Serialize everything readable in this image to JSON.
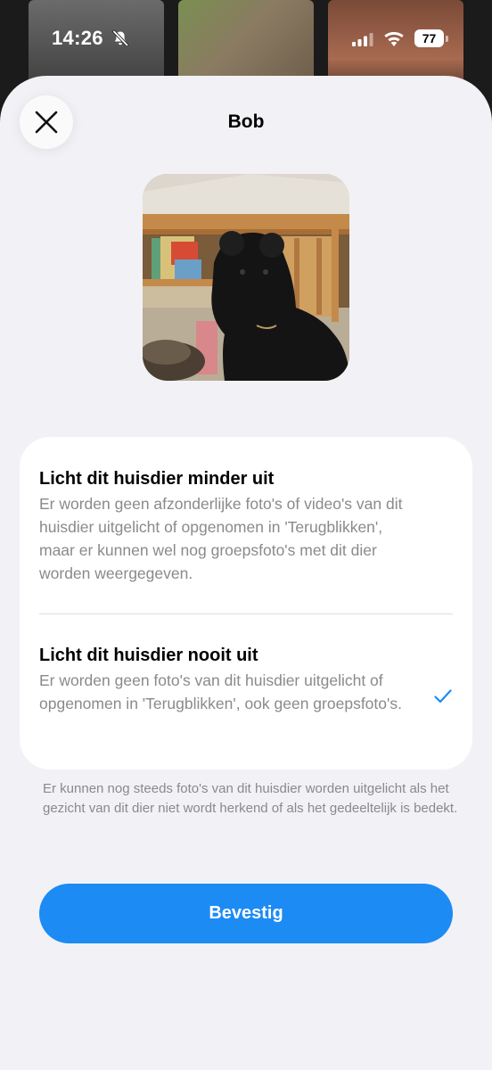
{
  "status_bar": {
    "time": "14:26",
    "battery": "77",
    "icons": [
      "bell-off-icon",
      "signal-icon",
      "wifi-icon",
      "battery-icon"
    ]
  },
  "sheet": {
    "title": "Bob",
    "close_icon": "close-icon",
    "photo": "pet-photo"
  },
  "options": [
    {
      "title": "Licht dit huisdier minder uit",
      "description": "Er worden geen afzonderlijke foto's of video's van dit huisdier uitgelicht of opgenomen in 'Terugblikken', maar er kunnen wel nog groepsfoto's met dit dier worden weergegeven.",
      "selected": false
    },
    {
      "title": "Licht dit huisdier nooit uit",
      "description": "Er worden geen foto's van dit huisdier uitgelicht of opgenomen in 'Terugblikken', ook geen groepsfoto's.",
      "selected": true
    }
  ],
  "footnote": "Er kunnen nog steeds foto's van dit huisdier worden uitgelicht als het gezicht van dit dier niet wordt herkend of als het gedeeltelijk is bedekt.",
  "confirm_label": "Bevestig",
  "colors": {
    "accent": "#1c8bf4",
    "sheet_background": "#f2f2f6",
    "card_background": "#ffffff",
    "secondary_text": "#8a8a8e"
  }
}
